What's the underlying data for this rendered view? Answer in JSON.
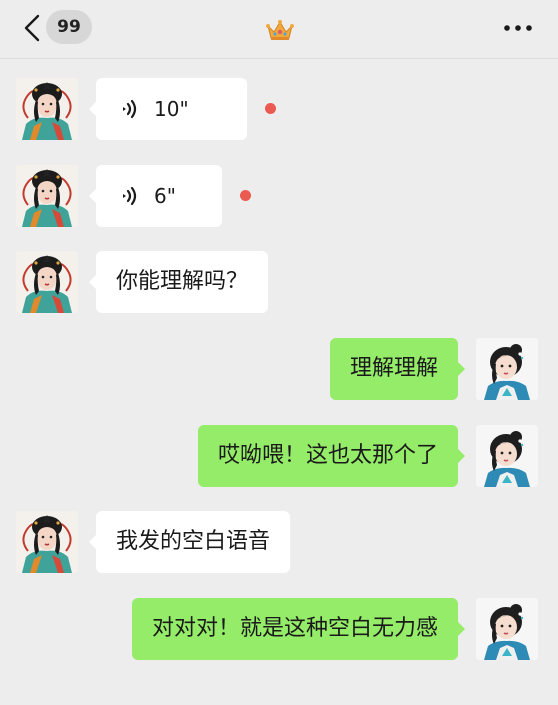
{
  "header": {
    "unread_count": "99",
    "title_icon": "crown-icon",
    "back_icon": "chevron-left-icon",
    "more_icon": "more-dots-icon"
  },
  "messages": [
    {
      "side": "left",
      "type": "voice",
      "duration": "10\"",
      "unread": true
    },
    {
      "side": "left",
      "type": "voice",
      "duration": "6\"",
      "unread": true
    },
    {
      "side": "left",
      "type": "text",
      "text": "你能理解吗？"
    },
    {
      "side": "right",
      "type": "text",
      "text": "理解理解"
    },
    {
      "side": "right",
      "type": "text",
      "text": "哎呦喂！这也太那个了"
    },
    {
      "side": "left",
      "type": "text",
      "text": "我发的空白语音"
    },
    {
      "side": "right",
      "type": "text",
      "text": "对对对！就是这种空白无力感"
    }
  ],
  "colors": {
    "background": "#ededed",
    "incoming_bubble": "#ffffff",
    "outgoing_bubble": "#95ec69",
    "unread_dot": "#ea5a50"
  }
}
